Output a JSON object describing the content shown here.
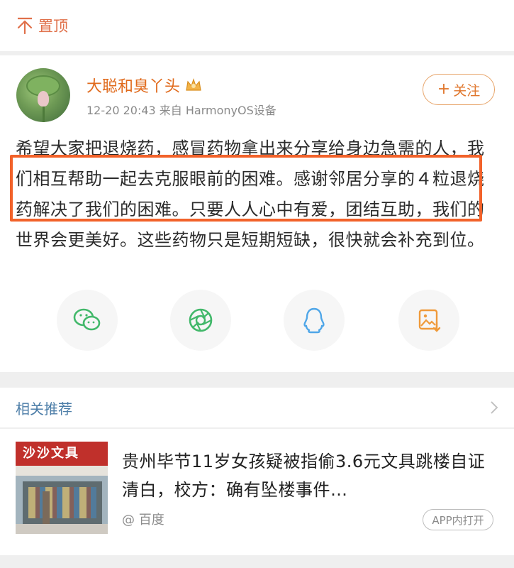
{
  "pin": {
    "label": "置顶"
  },
  "post": {
    "username": "大聪和臭丫头",
    "meta": "12-20 20:43 来自 HarmonyOS设备",
    "follow_label": "关注",
    "content": "希望大家把退烧药，感冒药物拿出来分享给身边急需的人，我们相互帮助一起去克服眼前的困难。感谢邻居分享的４粒退烧药解决了我们的困难。只要人人心中有爱，团结互助，我们的世界会更美好。这些药物只是短期短缺，很快就会补充到位。",
    "share_icons": [
      "wechat-icon",
      "moments-icon",
      "qq-icon",
      "save-image-icon"
    ],
    "colors": {
      "username": "#e06a1c",
      "highlight_border": "#f2622a"
    }
  },
  "related": {
    "title": "相关推荐",
    "item": {
      "thumb_sign": "沙沙文具",
      "title": "贵州毕节11岁女孩疑被指偷3.6元文具跳楼自证清白，校方：确有坠楼事件…",
      "source": "@ 百度",
      "app_button": "APP内打开"
    }
  }
}
